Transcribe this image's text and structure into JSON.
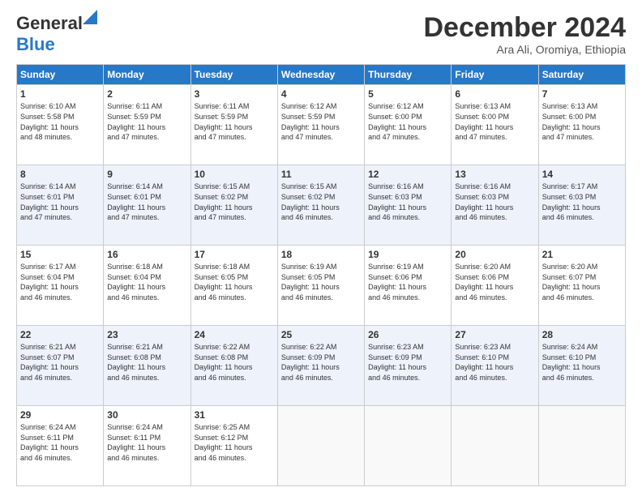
{
  "logo": {
    "line1": "General",
    "line2": "Blue"
  },
  "header": {
    "month": "December 2024",
    "location": "Ara Ali, Oromiya, Ethiopia"
  },
  "days_of_week": [
    "Sunday",
    "Monday",
    "Tuesday",
    "Wednesday",
    "Thursday",
    "Friday",
    "Saturday"
  ],
  "weeks": [
    [
      {
        "day": "1",
        "text": "Sunrise: 6:10 AM\nSunset: 5:58 PM\nDaylight: 11 hours\nand 48 minutes."
      },
      {
        "day": "2",
        "text": "Sunrise: 6:11 AM\nSunset: 5:59 PM\nDaylight: 11 hours\nand 47 minutes."
      },
      {
        "day": "3",
        "text": "Sunrise: 6:11 AM\nSunset: 5:59 PM\nDaylight: 11 hours\nand 47 minutes."
      },
      {
        "day": "4",
        "text": "Sunrise: 6:12 AM\nSunset: 5:59 PM\nDaylight: 11 hours\nand 47 minutes."
      },
      {
        "day": "5",
        "text": "Sunrise: 6:12 AM\nSunset: 6:00 PM\nDaylight: 11 hours\nand 47 minutes."
      },
      {
        "day": "6",
        "text": "Sunrise: 6:13 AM\nSunset: 6:00 PM\nDaylight: 11 hours\nand 47 minutes."
      },
      {
        "day": "7",
        "text": "Sunrise: 6:13 AM\nSunset: 6:00 PM\nDaylight: 11 hours\nand 47 minutes."
      }
    ],
    [
      {
        "day": "8",
        "text": "Sunrise: 6:14 AM\nSunset: 6:01 PM\nDaylight: 11 hours\nand 47 minutes."
      },
      {
        "day": "9",
        "text": "Sunrise: 6:14 AM\nSunset: 6:01 PM\nDaylight: 11 hours\nand 47 minutes."
      },
      {
        "day": "10",
        "text": "Sunrise: 6:15 AM\nSunset: 6:02 PM\nDaylight: 11 hours\nand 47 minutes."
      },
      {
        "day": "11",
        "text": "Sunrise: 6:15 AM\nSunset: 6:02 PM\nDaylight: 11 hours\nand 46 minutes."
      },
      {
        "day": "12",
        "text": "Sunrise: 6:16 AM\nSunset: 6:03 PM\nDaylight: 11 hours\nand 46 minutes."
      },
      {
        "day": "13",
        "text": "Sunrise: 6:16 AM\nSunset: 6:03 PM\nDaylight: 11 hours\nand 46 minutes."
      },
      {
        "day": "14",
        "text": "Sunrise: 6:17 AM\nSunset: 6:03 PM\nDaylight: 11 hours\nand 46 minutes."
      }
    ],
    [
      {
        "day": "15",
        "text": "Sunrise: 6:17 AM\nSunset: 6:04 PM\nDaylight: 11 hours\nand 46 minutes."
      },
      {
        "day": "16",
        "text": "Sunrise: 6:18 AM\nSunset: 6:04 PM\nDaylight: 11 hours\nand 46 minutes."
      },
      {
        "day": "17",
        "text": "Sunrise: 6:18 AM\nSunset: 6:05 PM\nDaylight: 11 hours\nand 46 minutes."
      },
      {
        "day": "18",
        "text": "Sunrise: 6:19 AM\nSunset: 6:05 PM\nDaylight: 11 hours\nand 46 minutes."
      },
      {
        "day": "19",
        "text": "Sunrise: 6:19 AM\nSunset: 6:06 PM\nDaylight: 11 hours\nand 46 minutes."
      },
      {
        "day": "20",
        "text": "Sunrise: 6:20 AM\nSunset: 6:06 PM\nDaylight: 11 hours\nand 46 minutes."
      },
      {
        "day": "21",
        "text": "Sunrise: 6:20 AM\nSunset: 6:07 PM\nDaylight: 11 hours\nand 46 minutes."
      }
    ],
    [
      {
        "day": "22",
        "text": "Sunrise: 6:21 AM\nSunset: 6:07 PM\nDaylight: 11 hours\nand 46 minutes."
      },
      {
        "day": "23",
        "text": "Sunrise: 6:21 AM\nSunset: 6:08 PM\nDaylight: 11 hours\nand 46 minutes."
      },
      {
        "day": "24",
        "text": "Sunrise: 6:22 AM\nSunset: 6:08 PM\nDaylight: 11 hours\nand 46 minutes."
      },
      {
        "day": "25",
        "text": "Sunrise: 6:22 AM\nSunset: 6:09 PM\nDaylight: 11 hours\nand 46 minutes."
      },
      {
        "day": "26",
        "text": "Sunrise: 6:23 AM\nSunset: 6:09 PM\nDaylight: 11 hours\nand 46 minutes."
      },
      {
        "day": "27",
        "text": "Sunrise: 6:23 AM\nSunset: 6:10 PM\nDaylight: 11 hours\nand 46 minutes."
      },
      {
        "day": "28",
        "text": "Sunrise: 6:24 AM\nSunset: 6:10 PM\nDaylight: 11 hours\nand 46 minutes."
      }
    ],
    [
      {
        "day": "29",
        "text": "Sunrise: 6:24 AM\nSunset: 6:11 PM\nDaylight: 11 hours\nand 46 minutes."
      },
      {
        "day": "30",
        "text": "Sunrise: 6:24 AM\nSunset: 6:11 PM\nDaylight: 11 hours\nand 46 minutes."
      },
      {
        "day": "31",
        "text": "Sunrise: 6:25 AM\nSunset: 6:12 PM\nDaylight: 11 hours\nand 46 minutes."
      },
      {
        "day": "",
        "text": ""
      },
      {
        "day": "",
        "text": ""
      },
      {
        "day": "",
        "text": ""
      },
      {
        "day": "",
        "text": ""
      }
    ]
  ]
}
